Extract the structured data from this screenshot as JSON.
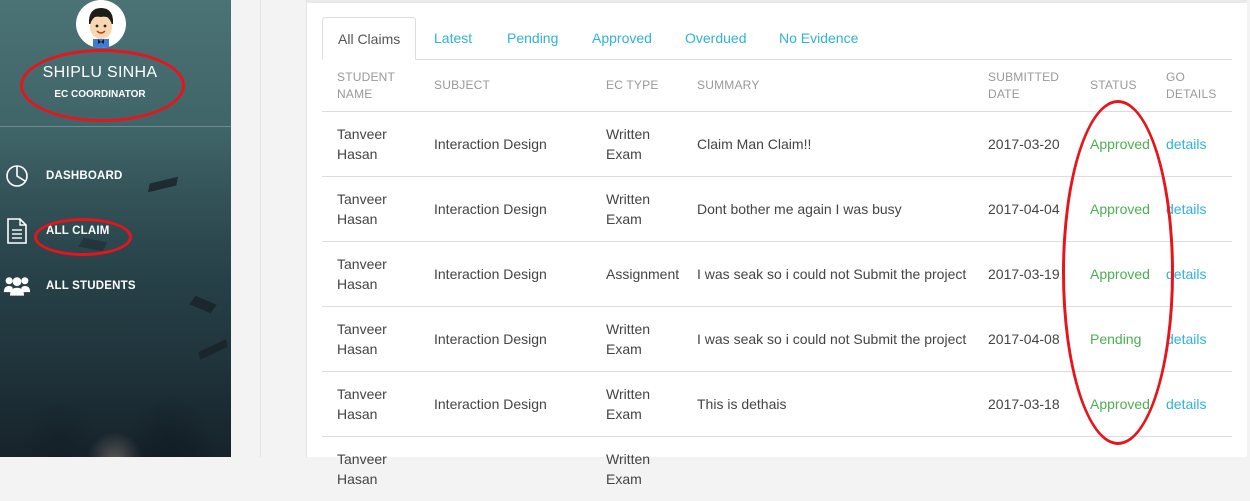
{
  "sidebar": {
    "user_name": "SHIPLU SINHA",
    "user_role": "EC COORDINATOR",
    "nav": [
      {
        "label": "DASHBOARD",
        "icon": "pie-chart-icon"
      },
      {
        "label": "ALL CLAIM",
        "icon": "document-icon"
      },
      {
        "label": "ALL STUDENTS",
        "icon": "users-icon"
      }
    ]
  },
  "tabs": [
    "All Claims",
    "Latest",
    "Pending",
    "Approved",
    "Overdued",
    "No Evidence"
  ],
  "active_tab": "All Claims",
  "table": {
    "headers": [
      "STUDENT NAME",
      "SUBJECT",
      "EC TYPE",
      "SUMMARY",
      "SUBMITTED DATE",
      "STATUS",
      "GO DETAILS"
    ],
    "rows": [
      {
        "student": "Tanveer Hasan",
        "subject": "Interaction Design",
        "ec_type": "Written Exam",
        "summary": "Claim Man Claim!!",
        "date": "2017-03-20",
        "status": "Approved",
        "details": "details"
      },
      {
        "student": "Tanveer Hasan",
        "subject": "Interaction Design",
        "ec_type": "Written Exam",
        "summary": "Dont bother me again I was busy",
        "date": "2017-04-04",
        "status": "Approved",
        "details": "details"
      },
      {
        "student": "Tanveer Hasan",
        "subject": "Interaction Design",
        "ec_type": "Assignment",
        "summary": "I was seak so i could not Submit the project",
        "date": "2017-03-19",
        "status": "Approved",
        "details": "details"
      },
      {
        "student": "Tanveer Hasan",
        "subject": "Interaction Design",
        "ec_type": "Written Exam",
        "summary": "I was seak so i could not Submit the project",
        "date": "2017-04-08",
        "status": "Pending",
        "details": "details"
      },
      {
        "student": "Tanveer Hasan",
        "subject": "Interaction Design",
        "ec_type": "Written Exam",
        "summary": "This is dethais",
        "date": "2017-03-18",
        "status": "Approved",
        "details": "details"
      },
      {
        "student": "Tanveer Hasan",
        "subject": "",
        "ec_type": "Written Exam",
        "summary": "",
        "date": "",
        "status": "",
        "details": ""
      }
    ]
  },
  "colors": {
    "accent": "#2fb3d8",
    "status_green": "#4caf50",
    "annotation_red": "#e8141b",
    "sidebar_bg": "#3f6468"
  }
}
